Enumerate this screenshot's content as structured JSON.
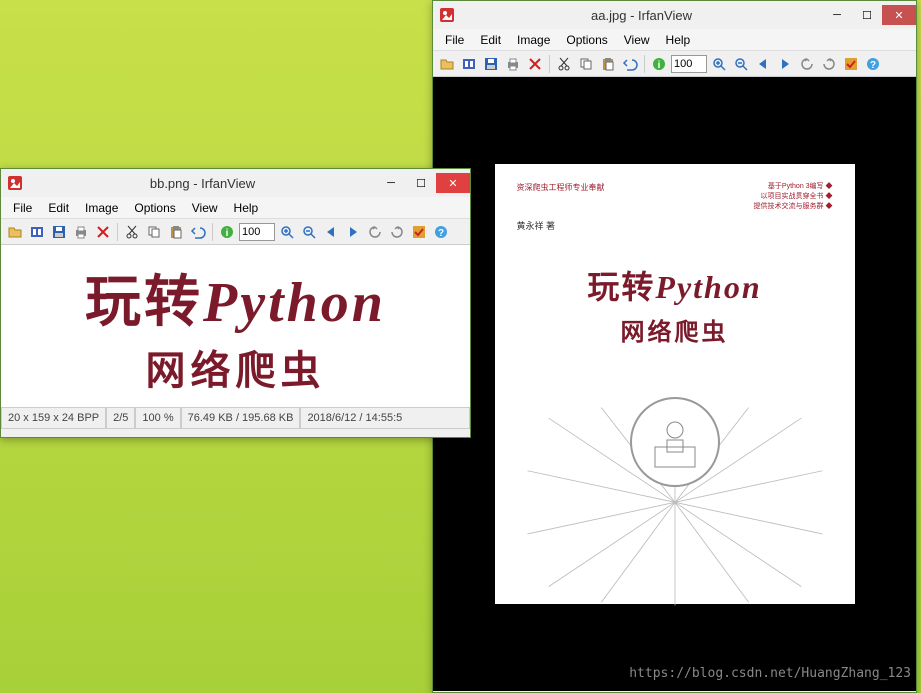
{
  "win_aa": {
    "title": "aa.jpg - IrfanView",
    "menu": [
      "File",
      "Edit",
      "Image",
      "Options",
      "View",
      "Help"
    ],
    "zoom": "100"
  },
  "win_bb": {
    "title": "bb.png - IrfanView",
    "menu": [
      "File",
      "Edit",
      "Image",
      "Options",
      "View",
      "Help"
    ],
    "zoom": "100",
    "status": {
      "dims": "20 x 159 x 24 BPP",
      "index": "2/5",
      "zoom_pct": "100 %",
      "size": "76.49 KB / 195.68 KB",
      "date": "2018/6/12 / 14:55:5"
    }
  },
  "book": {
    "top_left": "资深爬虫工程师专业奉献",
    "top_right_1": "基于Python 3编写 ◆",
    "top_right_2": "以项目实战贯穿全书 ◆",
    "top_right_3": "提供技术交流与服务群 ◆",
    "author": "黄永祥 著",
    "title_l1_a": "玩转",
    "title_l1_b": "Python",
    "title_l2": "网络爬虫"
  },
  "watermark": "https://blog.csdn.net/HuangZhang_123"
}
